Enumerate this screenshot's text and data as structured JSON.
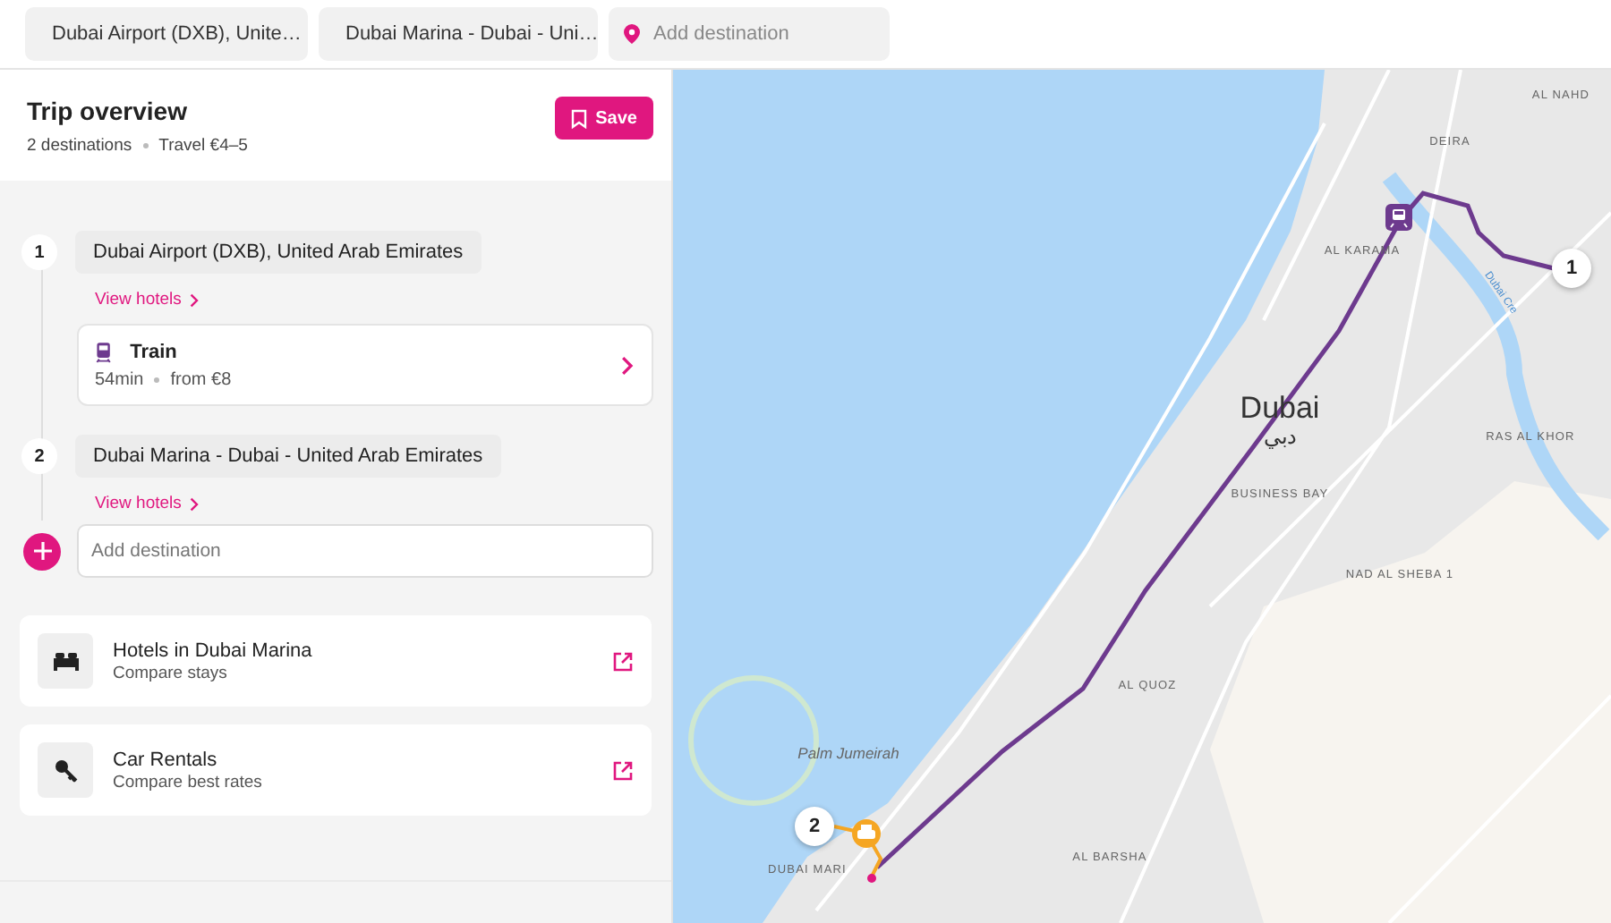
{
  "search_bar": {
    "stops": [
      {
        "label": "Dubai Airport (DXB), Unite…"
      },
      {
        "label": "Dubai Marina - Dubai - Uni…"
      }
    ],
    "add_placeholder": "Add destination"
  },
  "trip": {
    "title": "Trip overview",
    "destinations": "2 destinations",
    "travel": "Travel €4–5",
    "save": "Save"
  },
  "itinerary": [
    {
      "kind": "stop",
      "number": "1",
      "name": "Dubai Airport (DXB), United Arab Emirates",
      "link": "View hotels"
    },
    {
      "kind": "leg",
      "mode": "Train",
      "duration": "54min",
      "price": "from €8"
    },
    {
      "kind": "stop",
      "number": "2",
      "name": "Dubai Marina - Dubai - United Arab Emirates",
      "link": "View hotels"
    }
  ],
  "add_destination": {
    "placeholder": "Add destination"
  },
  "offers": [
    {
      "kind": "hotel",
      "title": "Hotels in Dubai Marina",
      "subtitle": "Compare stays"
    },
    {
      "kind": "car",
      "title": "Car Rentals",
      "subtitle": "Compare best rates"
    }
  ],
  "map": {
    "labels": [
      {
        "kind": "district",
        "text": "AL NAHD"
      },
      {
        "kind": "district",
        "text": "DEIRA"
      },
      {
        "kind": "district",
        "text": "AL KARAMA"
      },
      {
        "kind": "water",
        "text": "Dubai Cre"
      },
      {
        "kind": "city",
        "text": "Dubai"
      },
      {
        "kind": "city-arabic",
        "text": "دبي"
      },
      {
        "kind": "district",
        "text": "RAS AL KHOR"
      },
      {
        "kind": "district",
        "text": "BUSINESS BAY"
      },
      {
        "kind": "district",
        "text": "NAD AL SHEBA 1"
      },
      {
        "kind": "district",
        "text": "AL QUOZ"
      },
      {
        "kind": "island",
        "text": "Palm Jumeirah"
      },
      {
        "kind": "district",
        "text": "AL BARSHA"
      },
      {
        "kind": "district",
        "text": "DUBAI MARI"
      }
    ],
    "markers": [
      {
        "number": "1"
      },
      {
        "number": "2"
      }
    ]
  }
}
